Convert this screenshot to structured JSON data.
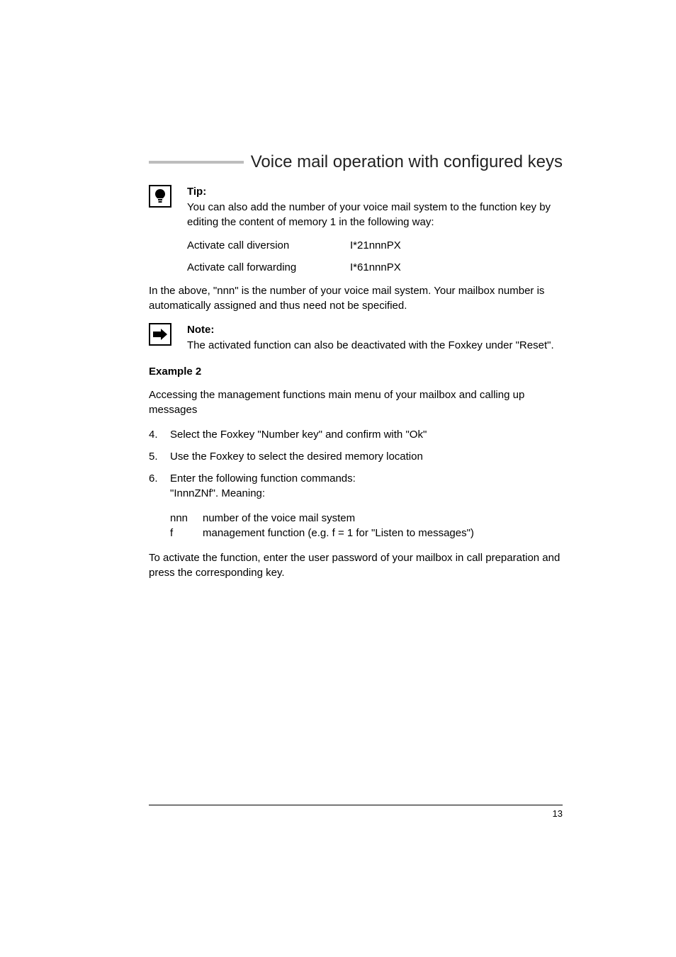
{
  "header": {
    "title": "Voice mail operation with configured keys"
  },
  "tip": {
    "label": "Tip:",
    "body": "You can also add the number of your voice mail system to the function key by editing the content of memory 1 in the following way:"
  },
  "cmds": [
    {
      "label": "Activate call diversion",
      "code": "I*21nnnPX"
    },
    {
      "label": "Activate call forwarding",
      "code": "I*61nnnPX"
    }
  ],
  "para_nnn": "In the above, \"nnn\" is the number of your voice mail system. Your mailbox number is automatically assigned and thus need not be specified.",
  "note": {
    "label": "Note:",
    "body": "The activated function can also be deactivated with the Foxkey under \"Reset\"."
  },
  "example": {
    "label": "Example 2",
    "intro": "Accessing the management functions main menu of your mailbox and calling up messages",
    "steps": [
      {
        "n": "4.",
        "t": "Select the Foxkey \"Number key\" and confirm with \"Ok\""
      },
      {
        "n": "5.",
        "t": "Use the Foxkey to select the desired memory location"
      },
      {
        "n": "6.",
        "t": "Enter the following function commands:\n\"InnnZNf\". Meaning:"
      }
    ],
    "defs": [
      {
        "k": "nnn",
        "v": "number of the voice mail system"
      },
      {
        "k": "f",
        "v": "management function (e.g. f = 1 for \"Listen to messages\")"
      }
    ],
    "closing": "To activate the function, enter the user password of your mailbox in call preparation and press the corresponding key."
  },
  "footer": {
    "page": "13"
  }
}
